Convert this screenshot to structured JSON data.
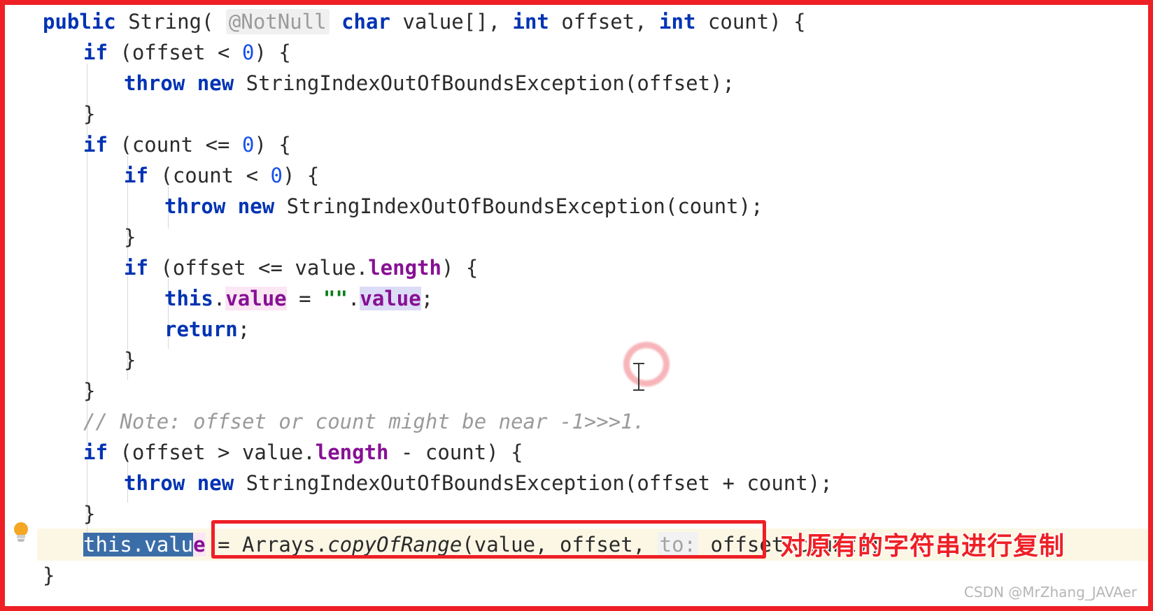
{
  "editor": {
    "language": "java",
    "theme": "light",
    "colors": {
      "background": "#ffffff",
      "keyword": "#0033b3",
      "number": "#1750eb",
      "field": "#871094",
      "string": "#067d17",
      "comment": "#9a9a9a",
      "inlay_hint": "#9b9b9b",
      "selection": "#3b6ea8",
      "caret_line": "#fcf7e4",
      "annotation_red": "#ee2026",
      "occurrence_write": "#fbe6f3",
      "occurrence_read": "#dcdcf7",
      "indent_guide": "#d8d8d8",
      "bulb": "#f5a623"
    },
    "gutter": {
      "bulb_icon": "lightbulb-icon",
      "bulb_tooltip": "Show Context Actions"
    },
    "code_lines": [
      {
        "index": 0,
        "indent": 0,
        "tokens": [
          {
            "text": "public",
            "style": "kw"
          },
          {
            "text": " String( ",
            "style": "plain"
          },
          {
            "text": "@NotNull",
            "style": "inlay"
          },
          {
            "text": " ",
            "style": "plain"
          },
          {
            "text": "char",
            "style": "kw"
          },
          {
            "text": " value[], ",
            "style": "plain"
          },
          {
            "text": "int",
            "style": "kw"
          },
          {
            "text": " offset, ",
            "style": "plain"
          },
          {
            "text": "int",
            "style": "kw"
          },
          {
            "text": " count) {",
            "style": "plain"
          }
        ]
      },
      {
        "index": 1,
        "indent": 1,
        "tokens": [
          {
            "text": "if",
            "style": "kw"
          },
          {
            "text": " (offset < ",
            "style": "plain"
          },
          {
            "text": "0",
            "style": "num"
          },
          {
            "text": ") {",
            "style": "plain"
          }
        ]
      },
      {
        "index": 2,
        "indent": 2,
        "tokens": [
          {
            "text": "throw",
            "style": "kw"
          },
          {
            "text": " ",
            "style": "plain"
          },
          {
            "text": "new",
            "style": "kw"
          },
          {
            "text": " StringIndexOutOfBoundsException(offset);",
            "style": "plain"
          }
        ]
      },
      {
        "index": 3,
        "indent": 1,
        "tokens": [
          {
            "text": "}",
            "style": "plain"
          }
        ]
      },
      {
        "index": 4,
        "indent": 1,
        "tokens": [
          {
            "text": "if",
            "style": "kw"
          },
          {
            "text": " (count <= ",
            "style": "plain"
          },
          {
            "text": "0",
            "style": "num"
          },
          {
            "text": ") {",
            "style": "plain"
          }
        ]
      },
      {
        "index": 5,
        "indent": 2,
        "tokens": [
          {
            "text": "if",
            "style": "kw"
          },
          {
            "text": " (count < ",
            "style": "plain"
          },
          {
            "text": "0",
            "style": "num"
          },
          {
            "text": ") {",
            "style": "plain"
          }
        ]
      },
      {
        "index": 6,
        "indent": 3,
        "tokens": [
          {
            "text": "throw",
            "style": "kw"
          },
          {
            "text": " ",
            "style": "plain"
          },
          {
            "text": "new",
            "style": "kw"
          },
          {
            "text": " StringIndexOutOfBoundsException(count);",
            "style": "plain"
          }
        ]
      },
      {
        "index": 7,
        "indent": 2,
        "tokens": [
          {
            "text": "}",
            "style": "plain"
          }
        ]
      },
      {
        "index": 8,
        "indent": 2,
        "tokens": [
          {
            "text": "if",
            "style": "kw"
          },
          {
            "text": " (offset <= value.",
            "style": "plain"
          },
          {
            "text": "length",
            "style": "field"
          },
          {
            "text": ") {",
            "style": "plain"
          }
        ]
      },
      {
        "index": 9,
        "indent": 3,
        "tokens": [
          {
            "text": "this",
            "style": "kw"
          },
          {
            "text": ".",
            "style": "plain"
          },
          {
            "text": "value",
            "style": "field hl-pink"
          },
          {
            "text": " = ",
            "style": "plain"
          },
          {
            "text": "\"\"",
            "style": "str"
          },
          {
            "text": ".",
            "style": "plain"
          },
          {
            "text": "value",
            "style": "field hl-lav"
          },
          {
            "text": ";",
            "style": "plain"
          }
        ]
      },
      {
        "index": 10,
        "indent": 3,
        "tokens": [
          {
            "text": "return",
            "style": "kw"
          },
          {
            "text": ";",
            "style": "plain"
          }
        ]
      },
      {
        "index": 11,
        "indent": 2,
        "tokens": [
          {
            "text": "}",
            "style": "plain"
          }
        ]
      },
      {
        "index": 12,
        "indent": 1,
        "tokens": [
          {
            "text": "}",
            "style": "plain"
          }
        ]
      },
      {
        "index": 13,
        "indent": 1,
        "tokens": [
          {
            "text": "// Note: offset or count might be near -1>>>1.",
            "style": "comment"
          }
        ]
      },
      {
        "index": 14,
        "indent": 1,
        "tokens": [
          {
            "text": "if",
            "style": "kw"
          },
          {
            "text": " (offset > value.",
            "style": "plain"
          },
          {
            "text": "length",
            "style": "field"
          },
          {
            "text": " - count) {",
            "style": "plain"
          }
        ]
      },
      {
        "index": 15,
        "indent": 2,
        "tokens": [
          {
            "text": "throw",
            "style": "kw"
          },
          {
            "text": " ",
            "style": "plain"
          },
          {
            "text": "new",
            "style": "kw"
          },
          {
            "text": " StringIndexOutOfBoundsException(offset + count);",
            "style": "plain"
          }
        ]
      },
      {
        "index": 16,
        "indent": 1,
        "tokens": [
          {
            "text": "}",
            "style": "plain"
          }
        ]
      },
      {
        "index": 17,
        "indent": 1,
        "is_caret_line": true,
        "tokens": [
          {
            "text": "this.valu",
            "style": "sel"
          },
          {
            "text": "e",
            "style": "field hl-pink"
          },
          {
            "text": " = ",
            "style": "plain"
          },
          {
            "text": "Arrays.",
            "style": "plain"
          },
          {
            "text": "copyOfRange",
            "style": "method-i"
          },
          {
            "text": "(value, offset, ",
            "style": "plain"
          },
          {
            "text": "to:",
            "style": "inlay-param"
          },
          {
            "text": " offset+count);",
            "style": "plain"
          }
        ]
      },
      {
        "index": 18,
        "indent": 0,
        "tokens": [
          {
            "text": "}",
            "style": "plain"
          }
        ]
      }
    ]
  },
  "annotations": {
    "highlight_box_label": "Arrays.copyOfRange(value, offset, to: offset+count);",
    "chinese_note": "对原有的字符串进行复制",
    "outer_border_color": "#ee2026"
  },
  "cursor": {
    "click_ripple": "click-ripple-indicator",
    "caret_shape": "i-beam-text-cursor"
  },
  "watermark": {
    "text": "CSDN @MrZhang_JAVAer"
  }
}
